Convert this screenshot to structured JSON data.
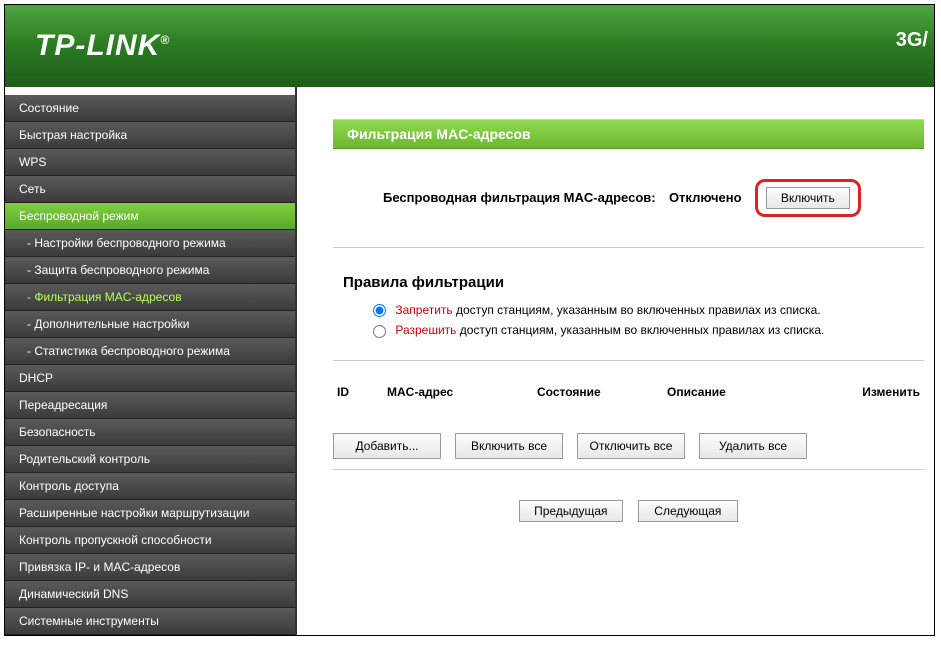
{
  "header": {
    "logo": "TP-LINK",
    "reg": "®",
    "right": "3G/"
  },
  "sidebar": {
    "items": [
      {
        "label": "Состояние",
        "type": "item"
      },
      {
        "label": "Быстрая настройка",
        "type": "item"
      },
      {
        "label": "WPS",
        "type": "item"
      },
      {
        "label": "Сеть",
        "type": "item"
      },
      {
        "label": "Беспроводной режим",
        "type": "active-parent"
      },
      {
        "label": "- Настройки беспроводного режима",
        "type": "sub"
      },
      {
        "label": "- Защита беспроводного режима",
        "type": "sub"
      },
      {
        "label": "- Фильтрация MAC-адресов",
        "type": "sub current"
      },
      {
        "label": "- Дополнительные настройки",
        "type": "sub"
      },
      {
        "label": "- Статистика беспроводного режима",
        "type": "sub"
      },
      {
        "label": "DHCP",
        "type": "item"
      },
      {
        "label": "Переадресация",
        "type": "item"
      },
      {
        "label": "Безопасность",
        "type": "item"
      },
      {
        "label": "Родительский контроль",
        "type": "item"
      },
      {
        "label": "Контроль доступа",
        "type": "item"
      },
      {
        "label": "Расширенные настройки маршрутизации",
        "type": "item"
      },
      {
        "label": "Контроль пропускной способности",
        "type": "item"
      },
      {
        "label": "Привязка IP- и MAC-адресов",
        "type": "item"
      },
      {
        "label": "Динамический DNS",
        "type": "item"
      },
      {
        "label": "Системные инструменты",
        "type": "item"
      }
    ]
  },
  "content": {
    "title": "Фильтрация MAC-адресов",
    "status": {
      "label": "Беспроводная фильтрация MAC-адресов:",
      "value": "Отключено",
      "enable_btn": "Включить"
    },
    "rules": {
      "heading": "Правила фильтрации",
      "deny_keyword": "Запретить",
      "deny_rest": " доступ станциям, указанным во включенных правилах из списка.",
      "allow_keyword": "Разрешить",
      "allow_rest": " доступ станциям, указанным во включенных правилах из списка."
    },
    "table": {
      "cols": [
        "ID",
        "MAC-адрес",
        "Состояние",
        "Описание",
        "Изменить"
      ]
    },
    "actions": {
      "add": "Добавить...",
      "enable_all": "Включить все",
      "disable_all": "Отключить все",
      "delete_all": "Удалить все"
    },
    "pager": {
      "prev": "Предыдущая",
      "next": "Следующая"
    }
  }
}
